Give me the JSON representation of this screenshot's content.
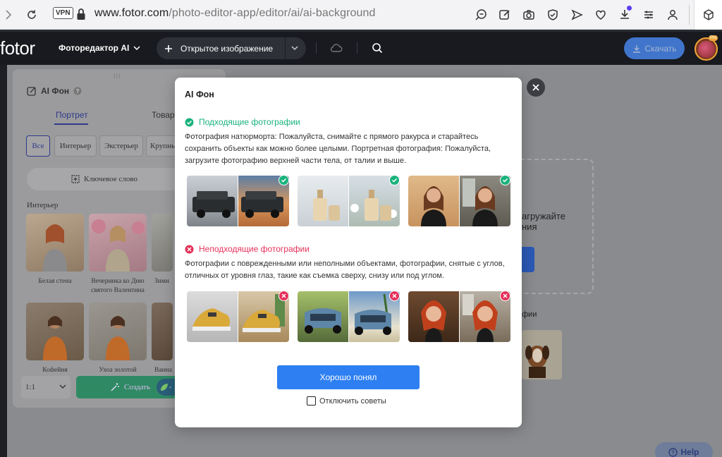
{
  "browser": {
    "url_host": "www.fotor.com",
    "url_path": "/photo-editor-app/editor/ai/ai-background",
    "vpn_label": "VPN",
    "icons": [
      "zoom-icon",
      "edit-icon",
      "camera-icon",
      "shield-icon",
      "send-icon",
      "heart-icon",
      "download-icon",
      "sliders-icon",
      "user-icon",
      "extension-icon"
    ],
    "download_dot_color": "#5b3df5"
  },
  "app": {
    "logo": "fotor",
    "editor_label": "Фоторедактор AI",
    "open_image_label": "Открытое изображение",
    "download_label": "Скачать",
    "pro_badge": "Pro",
    "accent_color": "#2d7ff2"
  },
  "left_panel": {
    "title": "AI Фон",
    "tabs": [
      "Портрет",
      "Товар"
    ],
    "filters": [
      "Все",
      "Интерьер",
      "Экстерьер",
      "Крупны"
    ],
    "keyword_label": "Ключевое слово",
    "section_label": "Интерьер",
    "thumbs_row1": [
      "Белая стена",
      "Вечеринка ко Дню святого Валентина",
      "Зимн"
    ],
    "thumbs_row2": [
      "Кофейня",
      "Уход золотой",
      "Ванна"
    ],
    "ratio_value": "1:1",
    "create_label": "Создать",
    "credit_label": "-"
  },
  "right_area": {
    "upload_text": "агружайте ния",
    "sample_label": "фии",
    "help_label": "Help"
  },
  "modal": {
    "title": "AI Фон",
    "good_heading": "Подходящие фотографии",
    "good_description": "Фотография натюрморта: Пожалуйста, снимайте с прямого ракурса и старайтесь сохранить объекты как можно более целыми. Портретная фотография: Пожалуйста, загрузите фотографию верхней части тела, от талии и выше.",
    "bad_heading": "Неподходящие фотографии",
    "bad_description": "Фотографии с поврежденными или неполными объектами, фотографии, снятые с углов, отличных от уровня глаз, такие как съемка сверху, снизу или под углом.",
    "ok_button": "Хорошо понял",
    "disable_tips_label": "Отключить советы",
    "good_color": "#1ab27c",
    "bad_color": "#e5315a"
  }
}
